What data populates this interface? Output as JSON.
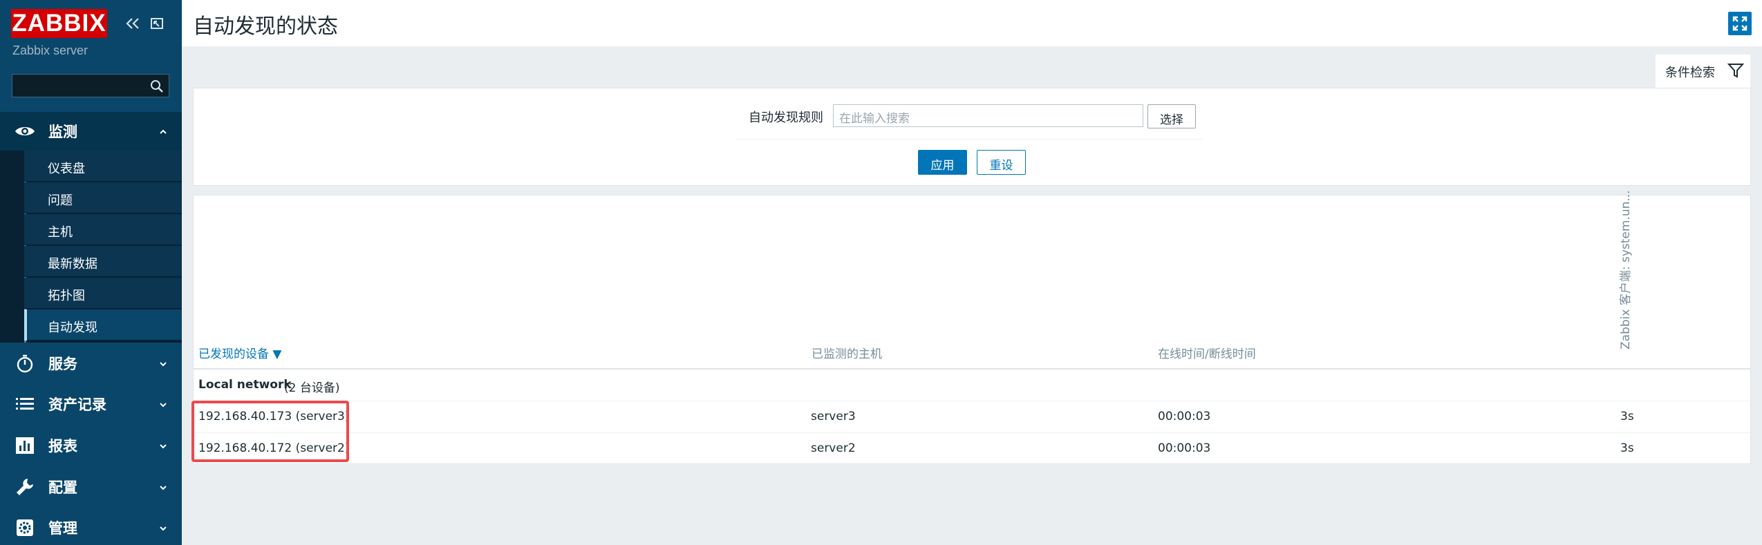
{
  "app": {
    "logo": "ZABBIX",
    "server_name": "Zabbix server"
  },
  "sidebar": {
    "search_placeholder": "",
    "items": [
      {
        "label": "监测",
        "icon": "eye-icon",
        "expanded": true
      },
      {
        "label": "服务",
        "icon": "stopwatch-icon"
      },
      {
        "label": "资产记录",
        "icon": "list-icon"
      },
      {
        "label": "报表",
        "icon": "bar-chart-icon"
      },
      {
        "label": "配置",
        "icon": "wrench-icon"
      },
      {
        "label": "管理",
        "icon": "gear-icon"
      }
    ],
    "submenu": [
      {
        "label": "仪表盘"
      },
      {
        "label": "问题"
      },
      {
        "label": "主机"
      },
      {
        "label": "最新数据"
      },
      {
        "label": "拓扑图"
      },
      {
        "label": "自动发现",
        "active": true
      }
    ]
  },
  "header": {
    "title": "自动发现的状态"
  },
  "filter": {
    "tab_label": "条件检索",
    "rule_label": "自动发现规则",
    "rule_placeholder": "在此输入搜索",
    "select_label": "选择",
    "apply_label": "应用",
    "reset_label": "重设"
  },
  "table": {
    "columns": {
      "device": "已发现的设备 ▼",
      "host": "已监测的主机",
      "uptime": "在线时间/断线时间",
      "check": "Zabbix 客户端: system.un..."
    },
    "group": {
      "name": "Local network",
      "count": "(2 台设备)"
    },
    "rows": [
      {
        "device": "192.168.40.173 (server3)",
        "host": "server3",
        "uptime": "00:00:03",
        "check": "3s"
      },
      {
        "device": "192.168.40.172 (server2)",
        "host": "server2",
        "uptime": "00:00:03",
        "check": "3s"
      }
    ]
  },
  "colors": {
    "sidebar_bg": "#0a466a",
    "logo_bg": "#d40000",
    "accent": "#0275b8",
    "highlight": "#ea4a4f"
  }
}
